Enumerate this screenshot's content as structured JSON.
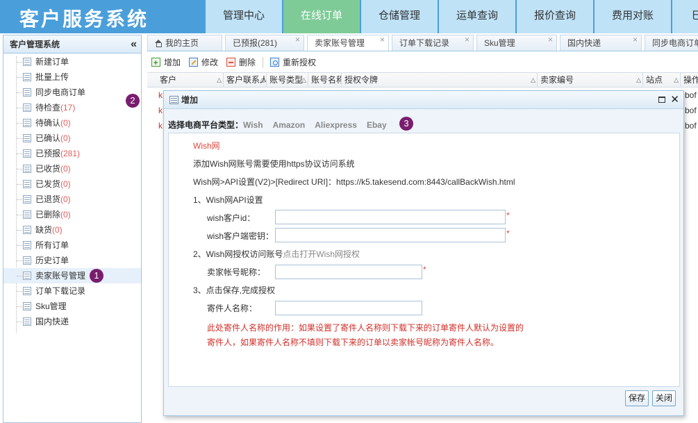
{
  "header": {
    "app_title": "客户服务系统",
    "nav": [
      "管理中心",
      "在线订单",
      "仓储管理",
      "运单查询",
      "报价查询",
      "费用对账",
      "巳"
    ],
    "active_nav": "在线订单"
  },
  "sidebar": {
    "title": "客户管理系统",
    "items": [
      {
        "label": "新建订单"
      },
      {
        "label": "批量上传"
      },
      {
        "label": "同步电商订单"
      },
      {
        "label": "待检查",
        "count": "(17)"
      },
      {
        "label": "待确认",
        "count": "(0)"
      },
      {
        "label": "已确认",
        "count": "(0)"
      },
      {
        "label": "已预报",
        "count": "(281)"
      },
      {
        "label": "已收货",
        "count": "(0)"
      },
      {
        "label": "已发货",
        "count": "(0)"
      },
      {
        "label": "已退货",
        "count": "(0)"
      },
      {
        "label": "已删除",
        "count": "(0)"
      },
      {
        "label": "缺货",
        "count": "(0)"
      },
      {
        "label": "所有订单"
      },
      {
        "label": "历史订单"
      },
      {
        "label": "卖家账号管理",
        "selected": true
      },
      {
        "label": "订单下载记录"
      },
      {
        "label": "Sku管理"
      },
      {
        "label": "国内快递"
      }
    ],
    "badge_selected": "1",
    "badge_collapse": "2"
  },
  "tabs": [
    {
      "label": "我的主页",
      "icon": "home-icon"
    },
    {
      "label": "已预报(281)"
    },
    {
      "label": "卖家账号管理",
      "active": true
    },
    {
      "label": "订单下载记录"
    },
    {
      "label": "Sku管理"
    },
    {
      "label": "国内快递"
    },
    {
      "label": "同步电商订单"
    }
  ],
  "toolbar": {
    "add": "增加",
    "edit": "修改",
    "delete": "删除",
    "reauth": "重新授权"
  },
  "grid": {
    "columns": [
      "客户",
      "客户联系人",
      "账号类型",
      "账号名称",
      "授权令牌",
      "卖家编号",
      "站点",
      "操作"
    ],
    "row_fragments": [
      {
        "left": "k",
        "right": "bof"
      },
      {
        "left": "k",
        "right": "bof"
      },
      {
        "left": "k",
        "right": "bof"
      }
    ]
  },
  "modal": {
    "title": "增加",
    "platform_label": "选择电商平台类型：",
    "platforms": [
      "Wish",
      "Amazon",
      "Aliexpress",
      "Ebay"
    ],
    "badge": "3",
    "section_title": "Wish网",
    "line_https": "添加Wish网账号需要使用https协议访问系统",
    "line_redirect": "Wish网>API设置(V2)>[Redirect URI]：https://k5.takesend.com:8443/callBackWish.html",
    "step1": "1、Wish网API设置",
    "client_id_label": "wish客户id：",
    "client_secret_label": "wish客户端密钥：",
    "step2_prefix": "2、Wish网授权访问账号",
    "step2_link": "点击打开Wish网授权",
    "nickname_label": "卖家帐号昵称：",
    "step3": "3、点击保存,完成授权",
    "sender_label": "寄件人名称：",
    "note_line1": "此处寄件人名称的作用：如果设置了寄件人名称则下载下来的订单寄件人默认为设置的",
    "note_line2": "寄件人，如果寄件人名称不填则下载下来的订单以卖家帐号昵称为寄件人名称。",
    "required_mark": "*",
    "client_id_value": "",
    "client_secret_value": "",
    "nickname_value": "",
    "sender_value": "",
    "save": "保存",
    "close": "关闭"
  },
  "colors": {
    "header_bg": "#4a9fdb",
    "nav_bg": "#bfe2f7",
    "nav_active": "#7fcb98",
    "badge": "#7a1d6e",
    "red_text": "#e0463c"
  }
}
